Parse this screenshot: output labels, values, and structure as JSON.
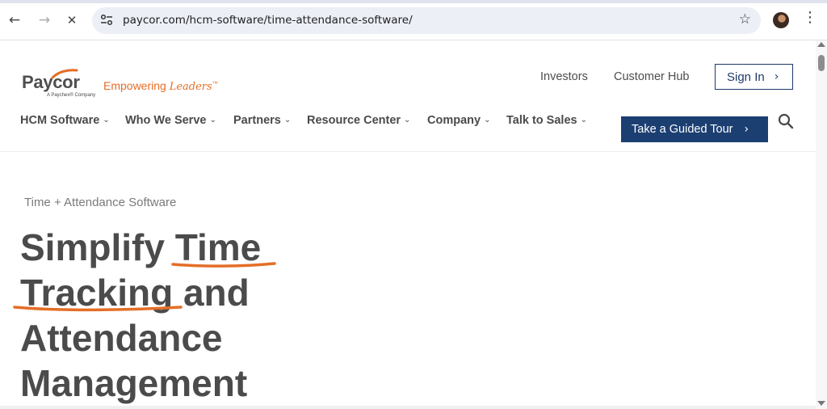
{
  "browser": {
    "url": "paycor.com/hcm-software/time-attendance-software/",
    "back_icon": "←",
    "forward_icon": "→",
    "stop_icon": "✕",
    "star_icon": "☆",
    "menu_icon": "⋮"
  },
  "header": {
    "logo": {
      "wordmark": "Paycor",
      "sub": "A Paychex® Company",
      "tagline_prefix": "Empowering ",
      "tagline_script": "Leaders",
      "tagline_tm": "™"
    },
    "top_links": [
      "Investors",
      "Customer Hub"
    ],
    "sign_in_label": "Sign In",
    "nav": [
      "HCM Software",
      "Who We Serve",
      "Partners",
      "Resource Center",
      "Company",
      "Talk to Sales"
    ],
    "tour_label": "Take a Guided Tour"
  },
  "hero": {
    "eyebrow": "Time + Attendance Software",
    "headline_lines": [
      "Simplify Time",
      "Tracking and",
      "Attendance",
      "Management"
    ]
  },
  "colors": {
    "brand_orange": "#e46e26",
    "brand_navy": "#1c3f72",
    "text_gray": "#4b4b4b"
  }
}
